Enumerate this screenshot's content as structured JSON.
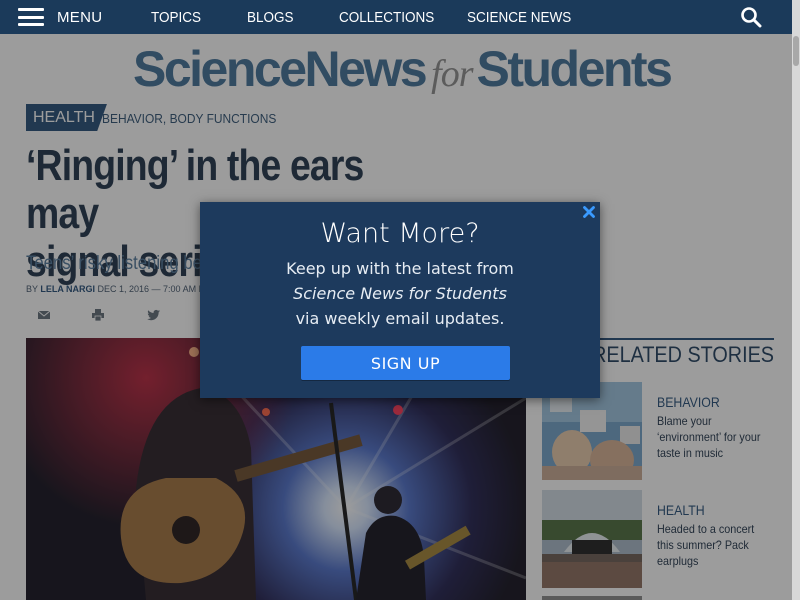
{
  "nav": {
    "menu_label": "MENU",
    "links": [
      "TOPICS",
      "BLOGS",
      "COLLECTIONS",
      "SCIENCE NEWS"
    ]
  },
  "logo": {
    "part1": "ScienceNews",
    "part2": "for",
    "part3": "Students"
  },
  "article": {
    "category": "HEALTH",
    "subcategories": "BEHAVIOR, BODY FUNCTIONS",
    "headline_line1": "‘Ringing’ in the ears may",
    "headline_line2": "signal seri",
    "dek": "Teens’ risky listening beha",
    "byline_prefix": "BY ",
    "byline_author": "LELA NARGI",
    "byline_date": " DEC 1, 2016 — 7:00 AM E"
  },
  "related": {
    "title": "RELATED STORIES",
    "items": [
      {
        "category": "BEHAVIOR",
        "headline": "Blame your ‘environment’ for your taste in music"
      },
      {
        "category": "HEALTH",
        "headline": "Headed to a concert this summer? Pack earplugs"
      }
    ]
  },
  "modal": {
    "title": "Want More?",
    "line1": "Keep up with the latest from",
    "line2": "Science News for Students",
    "line3": "via weekly email updates.",
    "button": "SIGN UP"
  },
  "colors": {
    "nav_bg": "#1b3a5a",
    "brand_blue": "#3d6d96",
    "modal_bg": "#1d3a5d",
    "button_blue": "#2b7be8"
  },
  "icons": [
    "hamburger-icon",
    "search-icon",
    "email-icon",
    "print-icon",
    "twitter-icon",
    "close-icon"
  ]
}
